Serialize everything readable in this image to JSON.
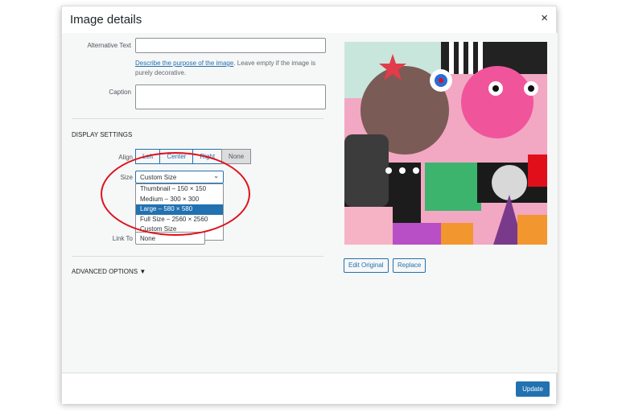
{
  "modal": {
    "title": "Image details",
    "close_glyph": "×"
  },
  "form": {
    "alt_label": "Alternative Text",
    "alt_value": "",
    "help_link": "Describe the purpose of the image",
    "help_rest": ". Leave empty if the image is purely decorative.",
    "caption_label": "Caption",
    "caption_value": "",
    "display_settings": "DISPLAY SETTINGS",
    "align_label": "Align",
    "align_options": [
      "Left",
      "Center",
      "Right",
      "None"
    ],
    "align_selected": "None",
    "size_label": "Size",
    "size_selected": "Custom Size",
    "size_options": [
      "Thumbnail – 150 × 150",
      "Medium – 300 × 300",
      "Large – 580 × 580",
      "Full Size – 2560 × 2560",
      "Custom Size"
    ],
    "size_highlighted": "Large – 580 × 580",
    "link_label": "Link To",
    "link_value": "None",
    "advanced": "ADVANCED OPTIONS",
    "advanced_glyph": "▼"
  },
  "preview": {
    "edit_original": "Edit Original",
    "replace": "Replace"
  },
  "footer": {
    "update": "Update"
  },
  "colors": {
    "accent": "#2271b1",
    "annotation": "#e0101a"
  }
}
